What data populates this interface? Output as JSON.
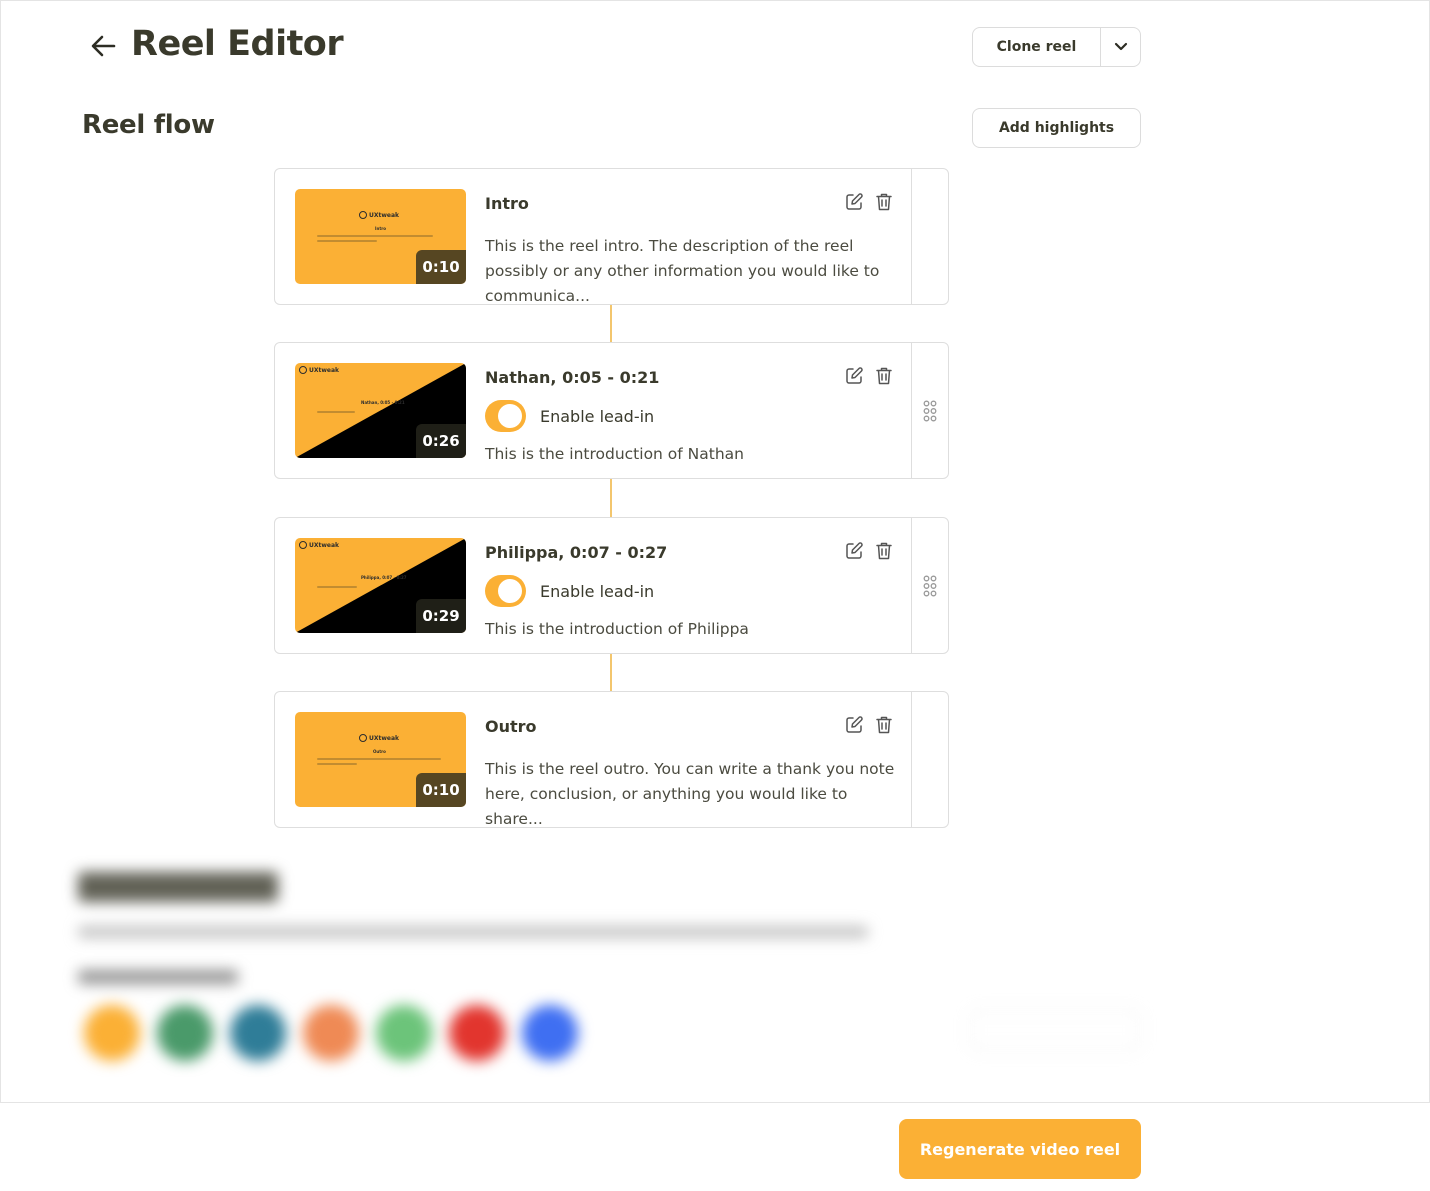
{
  "header": {
    "title": "Reel Editor",
    "clone_label": "Clone reel"
  },
  "reel_flow": {
    "title": "Reel flow",
    "add_highlights_label": "Add highlights",
    "cards": [
      {
        "title": "Intro",
        "duration": "0:10",
        "description": "This is the reel intro. The description of the reel possibly or any other information you would like to communica...",
        "thumb_style": "slide",
        "thumb_heading": "Intro"
      },
      {
        "title": "Nathan, 0:05 - 0:21",
        "duration": "0:26",
        "toggle_label": "Enable lead-in",
        "toggle_on": true,
        "description": "This is the introduction of Nathan",
        "thumb_style": "diagonal",
        "thumb_heading": "Nathan, 0:05 - 0:21"
      },
      {
        "title": "Philippa, 0:07 - 0:27",
        "duration": "0:29",
        "toggle_label": "Enable lead-in",
        "toggle_on": true,
        "description": "This is the introduction of Philippa",
        "thumb_style": "diagonal",
        "thumb_heading": "Philippa, 0:07 - 0:27"
      },
      {
        "title": "Outro",
        "duration": "0:10",
        "description": "This is the reel outro. You can write a thank you note here, conclusion, or anything you would like to share...",
        "thumb_style": "slide",
        "thumb_heading": "Outro"
      }
    ]
  },
  "branding": {
    "swatches": [
      "#fbb035",
      "#4a9a6a",
      "#2f7d98",
      "#ef8a55",
      "#6cc47a",
      "#e2352e",
      "#3f6ff2"
    ]
  },
  "footer": {
    "regenerate_label": "Regenerate video reel"
  },
  "colors": {
    "accent": "#fbb035",
    "text": "#3a3a2c"
  },
  "icons": {
    "back": "arrow-left-icon",
    "caret": "chevron-down-icon",
    "edit": "edit-icon",
    "delete": "trash-icon",
    "drag": "drag-handle-icon"
  }
}
